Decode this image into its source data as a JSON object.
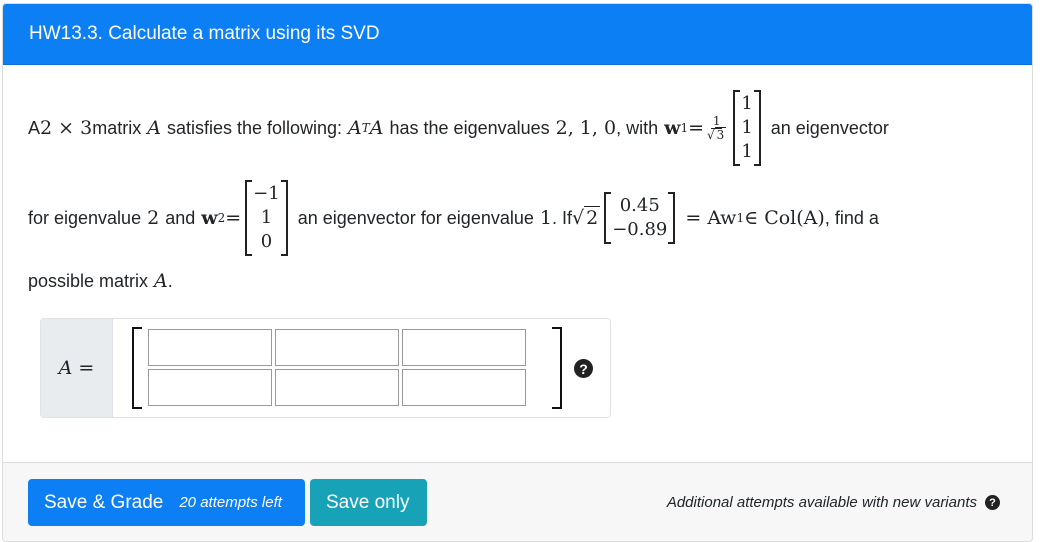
{
  "header": {
    "title": "HW13.3. Calculate a matrix using its SVD"
  },
  "question": {
    "t1": "A ",
    "m_2x3": "2 × 3",
    "t2": " matrix ",
    "m_A": "A",
    "t3": " satisfies the following: ",
    "m_ATA": "A",
    "m_T": "T",
    "t4": " has the eigenvalues ",
    "m_eigs": "2, 1, 0",
    "t5": ", with ",
    "m_w1": "w",
    "m_sub1": "1",
    "m_eq": " = ",
    "frac_num": "1",
    "frac_den": "3",
    "w1_vec": [
      "1",
      "1",
      "1"
    ],
    "t6": " an eigenvector",
    "t7": "for eigenvalue ",
    "m_2": "2",
    "t8": " and ",
    "m_w2": "w",
    "m_sub2": "2",
    "w2_vec": [
      "−1",
      "1",
      "0"
    ],
    "t9": " an eigenvector for eigenvalue ",
    "m_1": "1",
    "t10": ". If ",
    "sqrt_val": "2",
    "u_vec": [
      "0.45",
      "−0.89"
    ],
    "m_Aw1": "= Aw",
    "m_col": " ∈ Col(A)",
    "t11": ", find a",
    "t12": "possible matrix ",
    "m_A2": "A",
    "t13": "."
  },
  "answer": {
    "label": "A =",
    "cells": [
      "",
      "",
      "",
      "",
      "",
      ""
    ],
    "help_icon": "?"
  },
  "footer": {
    "save_grade": "Save & Grade",
    "attempts": "20 attempts left",
    "save_only": "Save only",
    "note": "Additional attempts available with new variants",
    "note_icon": "?"
  }
}
